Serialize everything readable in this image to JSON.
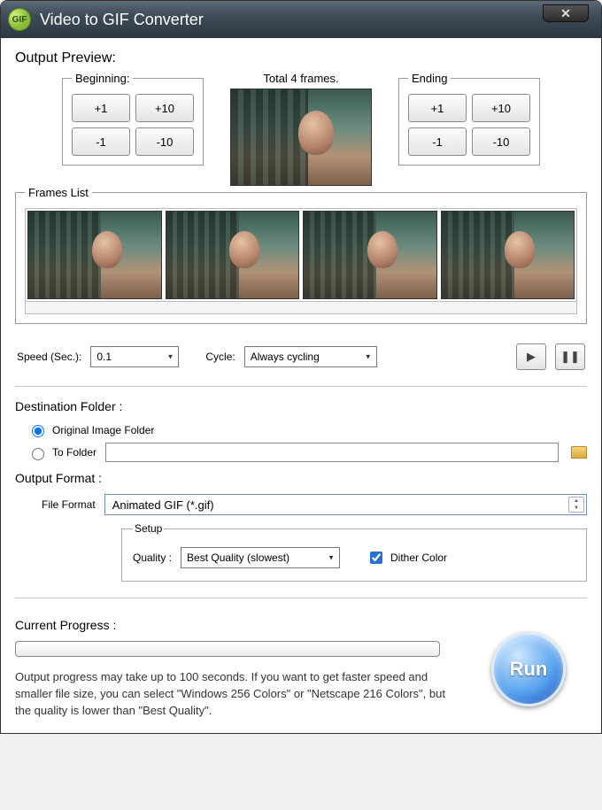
{
  "window": {
    "title": "Video to GIF Converter",
    "icon_label": "GIF"
  },
  "preview": {
    "section_title": "Output Preview:",
    "total_frames_label": "Total 4 frames.",
    "beginning": {
      "legend": "Beginning:",
      "plus1": "+1",
      "plus10": "+10",
      "minus1": "-1",
      "minus10": "-10"
    },
    "ending": {
      "legend": "Ending",
      "plus1": "+1",
      "plus10": "+10",
      "minus1": "-1",
      "minus10": "-10"
    }
  },
  "frames": {
    "legend": "Frames List",
    "count": 4
  },
  "controls": {
    "speed_label": "Speed (Sec.):",
    "speed_value": "0.1",
    "cycle_label": "Cycle:",
    "cycle_value": "Always cycling"
  },
  "destination": {
    "section_title": "Destination Folder :",
    "original_label": "Original Image Folder",
    "tofolder_label": "To Folder",
    "tofolder_path": "",
    "selected": "original"
  },
  "output": {
    "section_title": "Output Format :",
    "fileformat_label": "File Format",
    "fileformat_value": "Animated GIF (*.gif)",
    "setup_legend": "Setup",
    "quality_label": "Quality :",
    "quality_value": "Best Quality (slowest)",
    "dither_label": "Dither Color",
    "dither_checked": true
  },
  "progress": {
    "section_title": "Current Progress :",
    "hint": "Output progress may take up to 100 seconds. If you want to get faster speed and smaller file size, you can select \"Windows 256 Colors\" or \"Netscape 216 Colors\", but the quality is lower than \"Best Quality\"."
  },
  "actions": {
    "run_label": "Run"
  }
}
